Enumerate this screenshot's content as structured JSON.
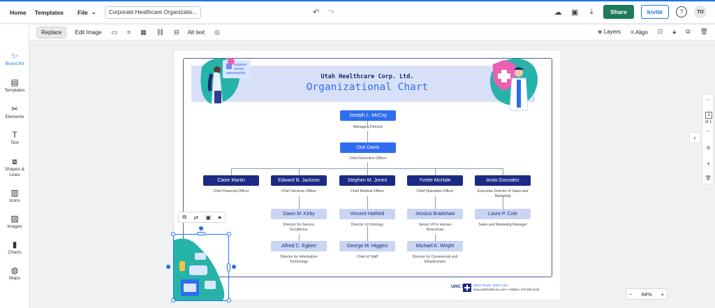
{
  "topbar": {
    "home": "Home",
    "templates": "Templates",
    "file": "File",
    "doc_name": "Corporate Healthcare Organizatio...",
    "share": "Share",
    "invite": "Invite",
    "help": "?",
    "avatar": "TO"
  },
  "toolbar2": {
    "replace": "Replace",
    "edit_image": "Edit Image",
    "alt_text": "Alt text",
    "layers": "Layers",
    "align": "Align"
  },
  "sidebar": {
    "items": [
      {
        "label": "Brand Kit",
        "icon": "magic-wand-icon"
      },
      {
        "label": "Templates",
        "icon": "templates-icon"
      },
      {
        "label": "Elements",
        "icon": "elements-icon"
      },
      {
        "label": "Text",
        "icon": "text-icon"
      },
      {
        "label": "Shapes & Lines",
        "icon": "shapes-icon"
      },
      {
        "label": "Icons",
        "icon": "icons-icon"
      },
      {
        "label": "Images",
        "icon": "images-icon"
      },
      {
        "label": "Charts",
        "icon": "charts-icon"
      },
      {
        "label": "Maps",
        "icon": "maps-icon"
      }
    ]
  },
  "chart": {
    "company": "Utah Healthcare Corp. Ltd.",
    "title": "Organizational Chart",
    "nodes": {
      "mccoy": {
        "name": "Joseph L. McCoy",
        "role": "Managing Director"
      },
      "davis": {
        "name": "Dori Davis",
        "role": "Chief Executive Officer"
      },
      "martin": {
        "name": "Claire Martin",
        "role": "Chief Financial Officer"
      },
      "jackson": {
        "name": "Edward B. Jackson",
        "role": "Chief Services Officer"
      },
      "jones": {
        "name": "Stephen M. Jones",
        "role": "Chief Medical Officer"
      },
      "mchale": {
        "name": "Yvette McHale",
        "role": "Chief Operation Officer"
      },
      "gonzalez": {
        "name": "Anita Gonzalez",
        "role": "Executive Director of Sales and Marketing"
      },
      "kirby": {
        "name": "Dawn M. Kirby",
        "role": "Director for Service Excellence"
      },
      "hatfield": {
        "name": "Vincent Hatfield",
        "role": "Director of Ontology"
      },
      "bradshaw": {
        "name": "Jessica Bradshaw",
        "role": "Senior VP in Human Resources"
      },
      "cole": {
        "name": "Laura P. Cole",
        "role": "Sales and Marketing Manager"
      },
      "egbert": {
        "name": "Alfred C. Egbert",
        "role": "Director for Information Technology"
      },
      "higgins": {
        "name": "George M. Higgins",
        "role": "Chief of Staff"
      },
      "wright": {
        "name": "Michael K. Wright",
        "role": "Director for Commercial and Infrastructure"
      }
    },
    "footer": {
      "logo": "UHC Ltd.",
      "tagline": "Better People. Better Care.",
      "contact": "www.utahhealthcare.com • Helpline: 202-555-0153"
    }
  },
  "rail": {
    "page": "1",
    "of": "of 1"
  },
  "zoom": {
    "minus": "−",
    "value": "64%",
    "plus": "+"
  },
  "colors": {
    "accent": "#1a73e8",
    "share": "#1e7b5c",
    "navy": "#1b2a85",
    "blue": "#2f6df0",
    "light": "#c9d5f1"
  }
}
